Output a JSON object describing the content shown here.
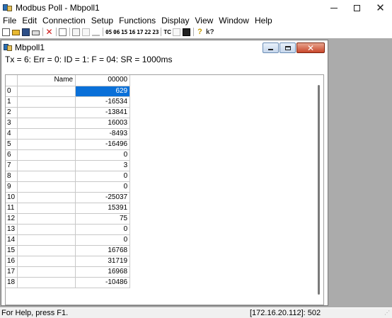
{
  "app": {
    "title": "Modbus Poll - Mbpoll1"
  },
  "window_controls": {
    "minimize": "–",
    "maximize": "□",
    "close": "✕"
  },
  "menu": [
    "File",
    "Edit",
    "Connection",
    "Setup",
    "Functions",
    "Display",
    "View",
    "Window",
    "Help"
  ],
  "toolbar": {
    "function_codes": [
      "05",
      "06",
      "15",
      "16",
      "17",
      "22",
      "23"
    ],
    "tc_label": "TC"
  },
  "child_window": {
    "title": "Mbpoll1",
    "status_line": "Tx = 6: Err = 0: ID = 1: F = 04: SR = 1000ms"
  },
  "grid": {
    "headers": {
      "name": "Name",
      "address": "00000"
    },
    "selected_row": 0,
    "rows": [
      {
        "index": "0",
        "name": "",
        "value": "629"
      },
      {
        "index": "1",
        "name": "",
        "value": "-16534"
      },
      {
        "index": "2",
        "name": "",
        "value": "-13841"
      },
      {
        "index": "3",
        "name": "",
        "value": "16003"
      },
      {
        "index": "4",
        "name": "",
        "value": "-8493"
      },
      {
        "index": "5",
        "name": "",
        "value": "-16496"
      },
      {
        "index": "6",
        "name": "",
        "value": "0"
      },
      {
        "index": "7",
        "name": "",
        "value": "3"
      },
      {
        "index": "8",
        "name": "",
        "value": "0"
      },
      {
        "index": "9",
        "name": "",
        "value": "0"
      },
      {
        "index": "10",
        "name": "",
        "value": "-25037"
      },
      {
        "index": "11",
        "name": "",
        "value": "15391"
      },
      {
        "index": "12",
        "name": "",
        "value": "75"
      },
      {
        "index": "13",
        "name": "",
        "value": "0"
      },
      {
        "index": "14",
        "name": "",
        "value": "0"
      },
      {
        "index": "15",
        "name": "",
        "value": "16768"
      },
      {
        "index": "16",
        "name": "",
        "value": "31719"
      },
      {
        "index": "17",
        "name": "",
        "value": "16968"
      },
      {
        "index": "18",
        "name": "",
        "value": "-10486"
      }
    ]
  },
  "statusbar": {
    "help_text": "For Help, press F1.",
    "connection": "[172.16.20.112]: 502"
  }
}
